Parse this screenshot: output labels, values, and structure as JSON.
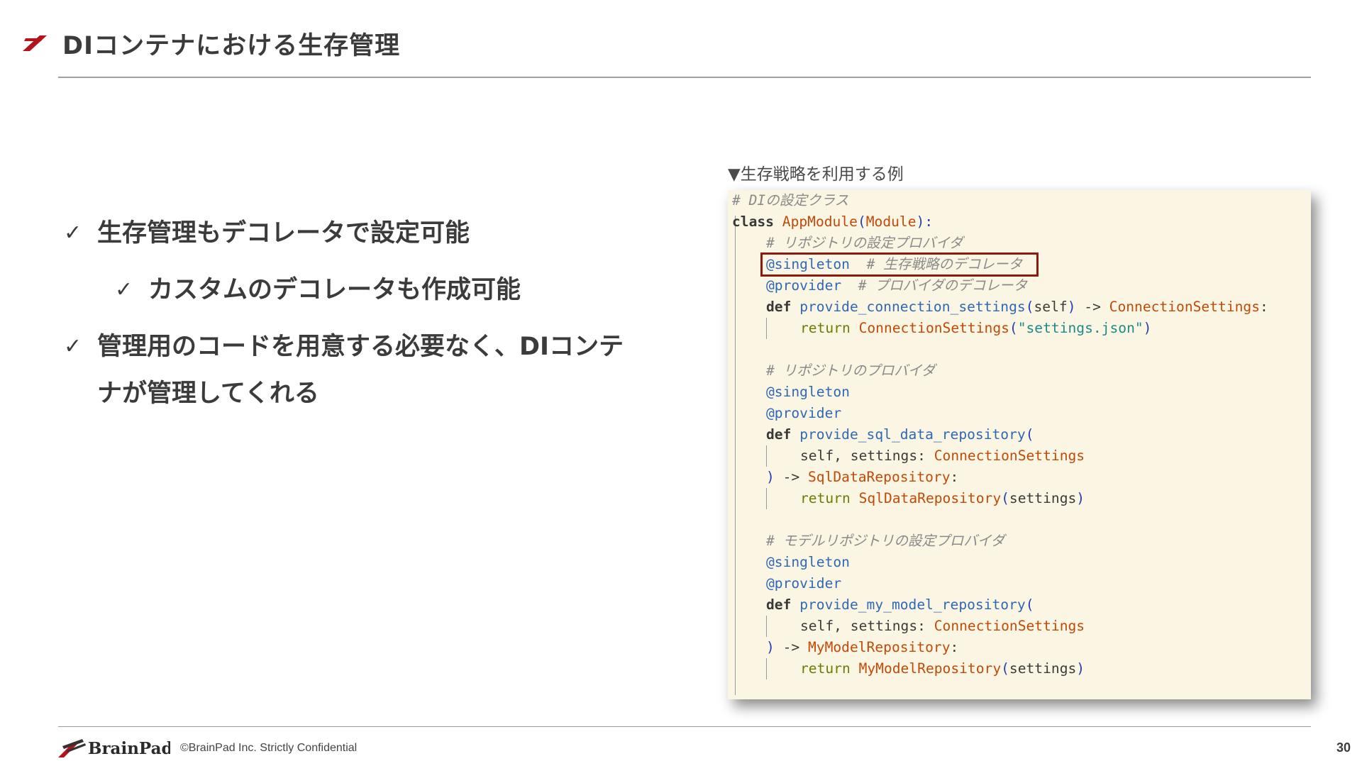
{
  "slide": {
    "title": "DIコンテナにおける生存管理",
    "page_number": "30"
  },
  "bullets": {
    "check_glyph": "✓",
    "item1": "生存管理もデコレータで設定可能",
    "item1_sub": "カスタムのデコレータも作成可能",
    "item2_line1": "管理用のコードを用意する必要なく、DIコンテ",
    "item2_line2": "ナが管理してくれる"
  },
  "code_example": {
    "caption": "▼生存戦略を利用する例",
    "lines": {
      "l1": "# DIの設定クラス",
      "l2_kw": "class",
      "l2_name": "AppModule",
      "l2_base": "Module",
      "l3": "# リポジトリの設定プロバイダ",
      "l4_dec": "@singleton",
      "l4_cm": "# 生存戦略のデコレータ",
      "l5_dec": "@provider",
      "l5_cm": "# プロバイダのデコレータ",
      "l6_fn": "provide_connection_settings",
      "l6_self": "self",
      "l6_ret": "ConnectionSettings",
      "l7_cls": "ConnectionSettings",
      "l7_str": "\"settings.json\"",
      "l9": "# リポジトリのプロバイダ",
      "l10_dec": "@singleton",
      "l11_dec": "@provider",
      "l12_fn": "provide_sql_data_repository",
      "l13_args": "self, settings: ",
      "l13_type": "ConnectionSettings",
      "l14_ret": "SqlDataRepository",
      "l15_cls": "SqlDataRepository",
      "l15_arg": "settings",
      "l17": "# モデルリポジトリの設定プロバイダ",
      "l18_dec": "@singleton",
      "l19_dec": "@provider",
      "l20_fn": "provide_my_model_repository",
      "l21_args": "self, settings: ",
      "l21_type": "ConnectionSettings",
      "l22_ret": "MyModelRepository",
      "l23_cls": "MyModelRepository",
      "l23_arg": "settings"
    },
    "keywords": {
      "def": "def",
      "return": "return",
      "arrow": "->"
    },
    "highlight_color": "#8b1a10"
  },
  "footer": {
    "brand": "BrainPad",
    "copyright": "©BrainPad Inc.  Strictly Confidential"
  },
  "colors": {
    "accent_red": "#b5121b",
    "code_background": "#fbf6e3"
  }
}
